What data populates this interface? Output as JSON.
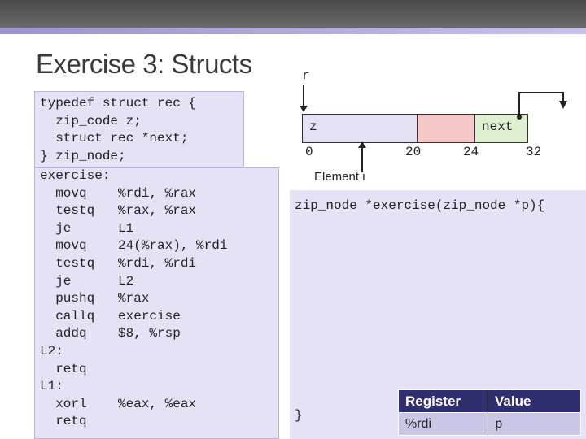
{
  "slide": {
    "title": "Exercise 3: Structs"
  },
  "typedef_code": "typedef struct rec {\n  zip_code z;\n  struct rec *next;\n} zip_node;",
  "assembly_code": "exercise:\n  movq    %rdi, %rax\n  testq   %rax, %rax\n  je      L1\n  movq    24(%rax), %rdi\n  testq   %rdi, %rdi\n  je      L2\n  pushq   %rax\n  callq   exercise\n  addq    $8, %rsp\nL2:\n  retq\nL1:\n  xorl    %eax, %eax\n  retq",
  "diagram": {
    "pointer_label": "r",
    "field_z": "z",
    "field_next": "next",
    "offsets": [
      "0",
      "20",
      "24",
      "32"
    ],
    "element_label": "Element i"
  },
  "answer": {
    "signature": "zip_node *exercise(zip_node *p){",
    "closing": "}"
  },
  "register_table": {
    "headers": [
      "Register",
      "Value"
    ],
    "rows": [
      [
        "%rdi",
        "p"
      ]
    ]
  },
  "colors": {
    "code_box_bg": "#e4e2f4",
    "cell_i": "#f4c8c8",
    "cell_next": "#dff0d0",
    "table_header": "#2f2f6f",
    "table_cell": "#c9c6e6"
  }
}
